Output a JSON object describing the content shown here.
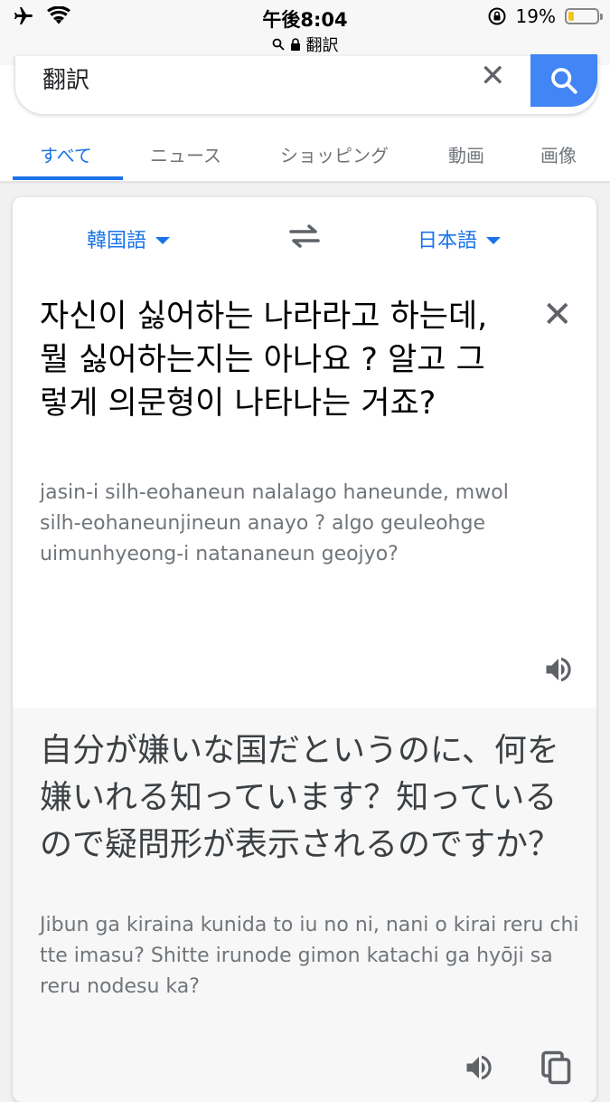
{
  "status_bar": {
    "time": "午後8:04",
    "url": "翻訳",
    "battery": "19%",
    "battery_level": 0.19
  },
  "search": {
    "query": "翻訳"
  },
  "tabs": [
    {
      "label": "すべて"
    },
    {
      "label": "ニュース"
    },
    {
      "label": "ショッピング"
    },
    {
      "label": "動画"
    },
    {
      "label": "画像"
    }
  ],
  "translate": {
    "source_lang": "韓国語",
    "target_lang": "日本語",
    "source_text": "자신이 싫어하는 나라라고 하는데, 뭘 싫어하는지는 아나요 ? 알고 그렇게 의문형이 나타나는 거죠?",
    "source_romanization": "jasin-i silh-eohaneun nalalago haneunde, mwol silh-eohaneunjineun anayo ? algo geuleohge uimunhyeong-i natananeun geojyo?",
    "target_text": "自分が嫌いな国だというのに、何を嫌いれる知っています？知っているので疑問形が表示されるのですか？",
    "target_romanization": "Jibun ga kiraina kunida to iu no ni, nani o kirai reru chi tte imasu? Shitte irunode gimon katachi ga hyōji sa reru nodesu ka?"
  },
  "colors": {
    "accent": "#1a73e8",
    "search_button": "#4285f4",
    "battery_fill": "#f5c518"
  },
  "icons": [
    "airplane-icon",
    "wifi-icon",
    "search-icon",
    "lock-icon",
    "orientation-lock-icon",
    "battery-icon",
    "clear-icon",
    "swap-icon",
    "close-icon",
    "speaker-icon",
    "copy-icon"
  ]
}
